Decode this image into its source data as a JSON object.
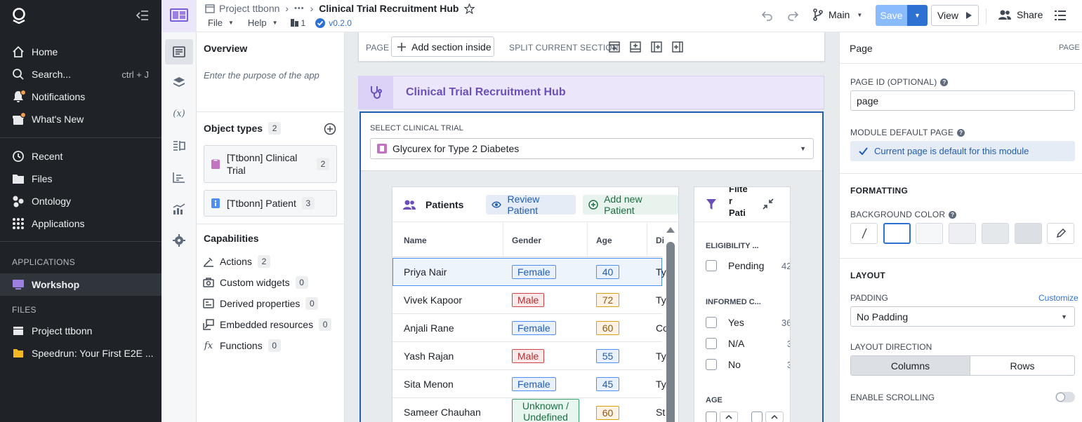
{
  "nav": {
    "items": [
      {
        "label": "Home"
      },
      {
        "label": "Search...",
        "shortcut": "ctrl + J"
      },
      {
        "label": "Notifications"
      },
      {
        "label": "What's New"
      },
      {
        "label": "Recent"
      },
      {
        "label": "Files"
      },
      {
        "label": "Ontology"
      },
      {
        "label": "Applications"
      }
    ],
    "applications_header": "APPLICATIONS",
    "workshop": "Workshop",
    "files_header": "FILES",
    "project": "Project ttbonn",
    "speedrun": "Speedrun: Your First E2E ..."
  },
  "header": {
    "breadcrumb_project": "Project ttbonn",
    "breadcrumb_more": "•••",
    "title": "Clinical Trial Recruitment Hub",
    "file_menu": "File",
    "help_menu": "Help",
    "pages_count": "1",
    "version": "v0.2.0",
    "branch": "Main",
    "save": "Save",
    "view": "View",
    "share": "Share"
  },
  "outline": {
    "overview_title": "Overview",
    "overview_placeholder": "Enter the purpose of the app",
    "object_types_title": "Object types",
    "object_types_count": "2",
    "object_types": [
      {
        "label": "[Ttbonn] Clinical Trial",
        "count": "2"
      },
      {
        "label": "[Ttbonn] Patient",
        "count": "3"
      }
    ],
    "capabilities_title": "Capabilities",
    "capabilities": [
      {
        "label": "Actions",
        "count": "2"
      },
      {
        "label": "Custom widgets",
        "count": "0"
      },
      {
        "label": "Derived properties",
        "count": "0"
      },
      {
        "label": "Embedded resources",
        "count": "0"
      },
      {
        "label": "Functions",
        "count": "0"
      }
    ]
  },
  "canvas": {
    "toolbar_page": "PAGE",
    "add_section": "Add section inside",
    "split_section": "SPLIT CURRENT SECTION",
    "hub_title": "Clinical Trial Recruitment Hub",
    "select_label": "SELECT CLINICAL TRIAL",
    "select_value": "Glycurex for Type 2 Diabetes",
    "patients": {
      "title": "Patients",
      "review": "Review Patient",
      "add": "Add new Patient",
      "columns": [
        "Name",
        "Gender",
        "Age",
        "Di"
      ],
      "rows": [
        {
          "name": "Priya Nair",
          "gender": "Female",
          "age": "40",
          "di": "Ty"
        },
        {
          "name": "Vivek Kapoor",
          "gender": "Male",
          "age": "72",
          "di": "Ty"
        },
        {
          "name": "Anjali Rane",
          "gender": "Female",
          "age": "60",
          "di": "Co"
        },
        {
          "name": "Yash Rajan",
          "gender": "Male",
          "age": "55",
          "di": "Ty"
        },
        {
          "name": "Sita Menon",
          "gender": "Female",
          "age": "45",
          "di": "Ty"
        },
        {
          "name": "Sameer Chauhan",
          "gender": "Unknown / Undefined",
          "age": "60",
          "di": "St"
        }
      ]
    },
    "filter": {
      "title_lines": [
        "Filte",
        "r",
        "Pati"
      ],
      "eligibility": "ELIGIBILITY ...",
      "eligibility_options": [
        {
          "label": "Pending",
          "count": "42"
        }
      ],
      "informed": "INFORMED C...",
      "informed_options": [
        {
          "label": "Yes",
          "count": "36"
        },
        {
          "label": "N/A",
          "count": "3"
        },
        {
          "label": "No",
          "count": "3"
        }
      ],
      "age": "AGE"
    }
  },
  "right": {
    "title": "Page",
    "tag": "PAGE",
    "page_id_label": "PAGE ID (OPTIONAL)",
    "page_id_value": "page",
    "module_default_label": "MODULE DEFAULT PAGE",
    "module_default_text": "Current page is default for this module",
    "formatting": "FORMATTING",
    "bg_color_label": "BACKGROUND COLOR",
    "layout": "LAYOUT",
    "padding_label": "PADDING",
    "customize": "Customize",
    "padding_value": "No Padding",
    "layout_direction_label": "LAYOUT DIRECTION",
    "columns": "Columns",
    "rows": "Rows",
    "scrolling_label": "ENABLE SCROLLING"
  },
  "colors": {
    "nav_bg": "#1f2328",
    "accent_purple": "#6a4fb8",
    "primary_blue": "#2d72d2",
    "notification_dot": "#f29d49"
  }
}
